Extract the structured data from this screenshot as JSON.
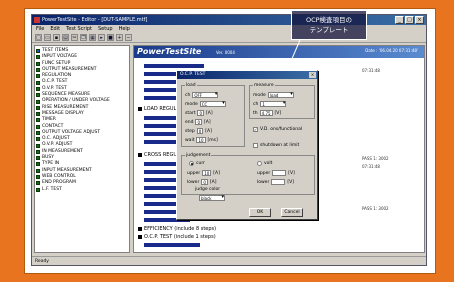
{
  "app": {
    "title": "PowerTestSite - Editor - [DUT-SAMPLE.mtf]",
    "menu": [
      "File",
      "Edit",
      "Test Script",
      "Setup",
      "Help"
    ],
    "status": "Ready"
  },
  "toolbar_icons": [
    "new-icon",
    "open-icon",
    "save-icon",
    "print-icon",
    "cut-icon",
    "copy-icon",
    "paste-icon",
    "run-icon",
    "stop-icon",
    "add-icon",
    "delete-icon"
  ],
  "tree": {
    "items": [
      {
        "label": "TEST ITEMS",
        "kind": "folder"
      },
      {
        "label": "INPUT VOLTAGE",
        "kind": "item"
      },
      {
        "label": "FUNC SETUP",
        "kind": "item"
      },
      {
        "label": "OUTPUT MEASUREMENT",
        "kind": "item"
      },
      {
        "label": "REGULATION",
        "kind": "item"
      },
      {
        "label": "O.C.P. TEST",
        "kind": "item"
      },
      {
        "label": "O.V.P. TEST",
        "kind": "item"
      },
      {
        "label": "SEQUENCE MEASURE",
        "kind": "item"
      },
      {
        "label": "OPERATION / UNDER VOLTAGE",
        "kind": "item"
      },
      {
        "label": "RISE MEASUREMENT",
        "kind": "item"
      },
      {
        "label": "MESSAGE DISPLAY",
        "kind": "item"
      },
      {
        "label": "TIMER",
        "kind": "item"
      },
      {
        "label": "CONTACT",
        "kind": "item"
      },
      {
        "label": "OUTPUT VOLTAGE ADJUST",
        "kind": "item"
      },
      {
        "label": "O.C. ADJUST",
        "kind": "item"
      },
      {
        "label": "O.V.P. ADJUST",
        "kind": "item"
      },
      {
        "label": "IN MEASUREMENT",
        "kind": "item"
      },
      {
        "label": "BUSY",
        "kind": "item"
      },
      {
        "label": "TYPE IN",
        "kind": "item"
      },
      {
        "label": "INPUT MEASUREMENT",
        "kind": "item"
      },
      {
        "label": "WEB CONTROL",
        "kind": "item"
      },
      {
        "label": "END PROGRAM",
        "kind": "item"
      },
      {
        "label": "L.F. TEST",
        "kind": "item"
      }
    ]
  },
  "main": {
    "brand": "PowerTestSite",
    "version": "Ver. 0004",
    "info": "Date : '06.04.20 07:31:48'",
    "rows": [
      {
        "label": "LOAD REGULA",
        "time": "07:31:48"
      },
      {
        "label": "CROSS REGUL",
        "time": ""
      },
      {
        "label": "EFFICIENCY (include 8 steps)",
        "time": ""
      },
      {
        "label": "O.C.P. TEST (include 1 steps)",
        "time": ""
      }
    ],
    "right_values": [
      "PASS 1: 3002",
      "PASS 1: 3002"
    ],
    "right_times": [
      "07:31:48",
      "07:31:48"
    ]
  },
  "dialog": {
    "title": "O.C.P. TEST",
    "load_group": "load",
    "measure_group": "measure",
    "judgement_group": "judgement",
    "load_fields": [
      {
        "label": "ch",
        "value": "OFF"
      },
      {
        "label": "mode",
        "value": "CC"
      },
      {
        "label": "start",
        "value": "0",
        "unit": "[A]"
      },
      {
        "label": "end",
        "value": "0",
        "unit": "[A]"
      },
      {
        "label": "step",
        "value": "0",
        "unit": "[A]"
      },
      {
        "label": "wait",
        "value": "10",
        "unit": "[ms]"
      }
    ],
    "measure_fields": [
      {
        "label": "mode",
        "value": "load"
      },
      {
        "label": "ch",
        "value": "1"
      },
      {
        "label": "th",
        "value": "4.75",
        "unit": "[V]"
      }
    ],
    "vcheck_label": "V.D. ons/functional",
    "shutdown_label": "shutdown at limit",
    "judge_radio_a": "curr",
    "judge_radio_b": "volt",
    "judge_upper_a": "10",
    "judge_lower_a": "0",
    "judge_upper_label": "upper",
    "judge_lower_label": "lower",
    "judge_unit": "[A]",
    "judge_unit_v": "[V]",
    "color_label": "judge color",
    "color_value": "black",
    "ok_label": "OK",
    "cancel_label": "Cancel"
  },
  "callout": {
    "line1": "OCP検査項目の",
    "line2": "テンプレート"
  },
  "colors": {
    "background": "#e8741f",
    "title_bar": "#0a246a",
    "header": "#1a3a8a"
  }
}
